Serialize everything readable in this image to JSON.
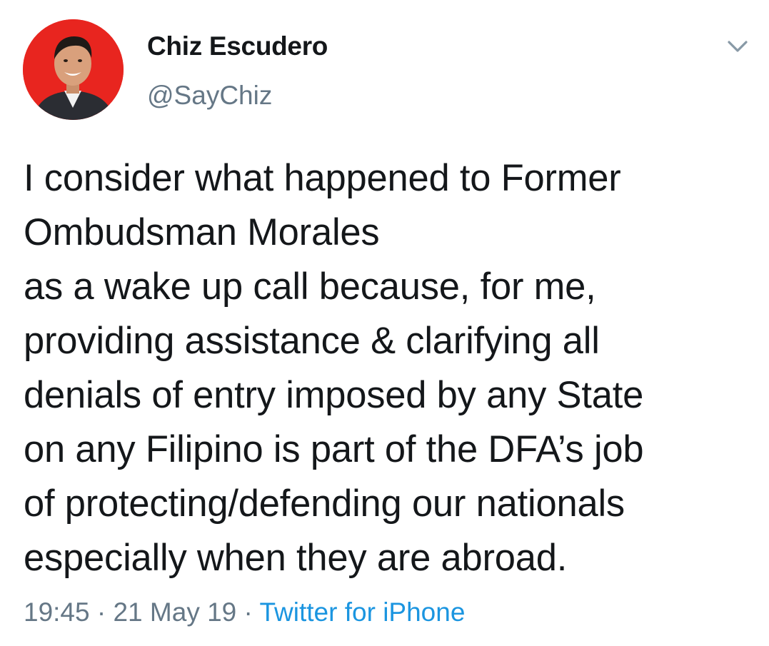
{
  "tweet": {
    "author": {
      "display_name": "Chiz Escudero",
      "handle": "@SayChiz",
      "avatar_background": "#e8251f"
    },
    "menu_icon": "chevron-down-icon",
    "text_lines": [
      "I consider what happened to Former",
      "Ombudsman Morales",
      "as a wake up call because, for me,",
      "providing assistance & clarifying all",
      "denials of entry imposed by any State",
      "on any Filipino is part of the DFA’s job",
      "of protecting/defending our nationals",
      "especially when they are abroad."
    ],
    "meta": {
      "time": "19:45",
      "separator": "·",
      "date": "21 May 19",
      "source": "Twitter for iPhone"
    }
  },
  "colors": {
    "text": "#14171a",
    "secondary": "#657786",
    "link": "#1b95e0"
  }
}
